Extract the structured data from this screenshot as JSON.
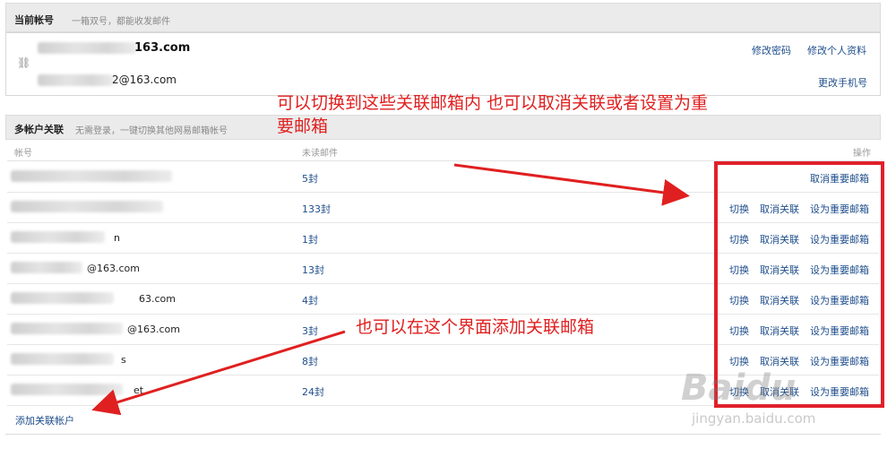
{
  "current": {
    "title": "当前帐号",
    "subtitle": "一箱双号，都能收发邮件",
    "primary_suffix": "163.com",
    "secondary_suffix": "2@163.com",
    "change_password": "修改密码",
    "edit_profile": "修改个人资料",
    "change_phone": "更改手机号"
  },
  "multi": {
    "title": "多帐户关联",
    "subtitle": "无需登录，一键切换其他网易邮箱帐号",
    "col_account": "帐号",
    "col_unread": "未读邮件",
    "col_ops": "操作",
    "rows": [
      {
        "account": "",
        "unread": "5封",
        "switch": "",
        "unlink": "",
        "important": "取消重要邮箱"
      },
      {
        "account": "",
        "unread": "133封",
        "switch": "切换",
        "unlink": "取消关联",
        "important": "设为重要邮箱"
      },
      {
        "account": "n",
        "unread": "1封",
        "switch": "切换",
        "unlink": "取消关联",
        "important": "设为重要邮箱"
      },
      {
        "account": "@163.com",
        "unread": "13封",
        "switch": "切换",
        "unlink": "取消关联",
        "important": "设为重要邮箱"
      },
      {
        "account": "63.com",
        "unread": "4封",
        "switch": "切换",
        "unlink": "取消关联",
        "important": "设为重要邮箱"
      },
      {
        "account": "@163.com",
        "unread": "3封",
        "switch": "切换",
        "unlink": "取消关联",
        "important": "设为重要邮箱"
      },
      {
        "account": "s",
        "unread": "8封",
        "switch": "切换",
        "unlink": "取消关联",
        "important": "设为重要邮箱"
      },
      {
        "account": "et",
        "unread": "24封",
        "switch": "切换",
        "unlink": "取消关联",
        "important": "设为重要邮箱"
      }
    ],
    "add_link": "添加关联帐户"
  },
  "annotations": {
    "note1_line1": "可以切换到这些关联邮箱内 也可以取消关联或者设置为重",
    "note1_line2": "要邮箱",
    "note2": "也可以在这个界面添加关联邮箱"
  },
  "watermark": {
    "logo": "Baidu",
    "url": "jingyan.baidu.com"
  },
  "colors": {
    "link": "#1f4e8c",
    "annotation": "#e02020",
    "header_bg": "#ebebeb"
  }
}
